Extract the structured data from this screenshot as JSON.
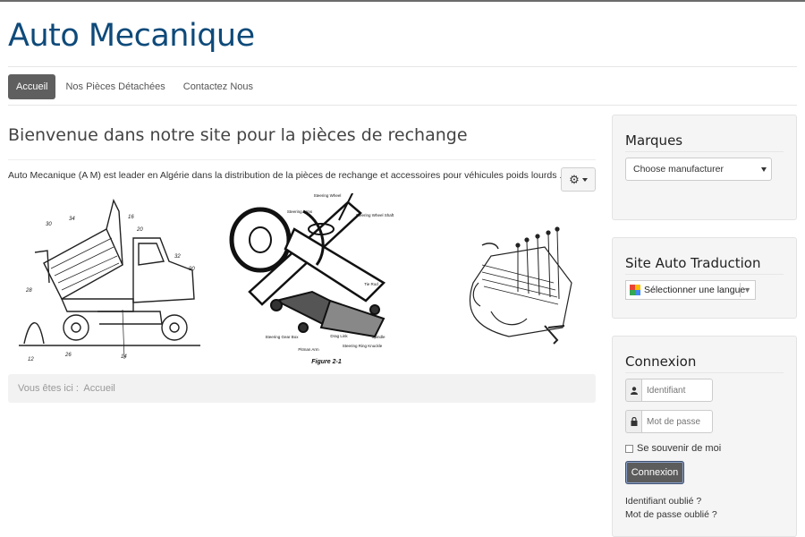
{
  "site": {
    "title": "Auto Mecanique"
  },
  "nav": {
    "items": [
      {
        "label": "Accueil",
        "active": true
      },
      {
        "label": "Nos Pièces Détachées",
        "active": false
      },
      {
        "label": "Contactez Nous",
        "active": false
      }
    ]
  },
  "main": {
    "heading": "Bienvenue dans notre site pour la pièces de rechange",
    "intro": "Auto Mecanique (A M) est leader en Algérie dans la distribution de la pièces de rechange et accessoires pour véhicules poids lourds ....",
    "images": {
      "truck": {
        "labels": [
          "30",
          "34",
          "16",
          "20",
          "32",
          "90",
          "28",
          "12",
          "26",
          "14"
        ]
      },
      "steering": {
        "labels": [
          "Steering Wheel",
          "Steering Arms",
          "Steering Wheel Shaft",
          "Tie Rod",
          "Steering Gear Box",
          "Pitman Arm",
          "Drag Link",
          "Spindle",
          "Steering Ring Knuckle"
        ],
        "caption": "Figure 2-1"
      }
    },
    "breadcrumb": {
      "prefix": "Vous êtes ici :",
      "current": "Accueil"
    }
  },
  "sidebar": {
    "marques": {
      "title": "Marques",
      "select_value": "Choose manufacturer"
    },
    "translate": {
      "title": "Site Auto Traduction",
      "select_value": "Sélectionner une langue"
    },
    "login": {
      "title": "Connexion",
      "username_placeholder": "Identifiant",
      "password_placeholder": "Mot de passe",
      "remember_label": "Se souvenir de moi",
      "submit_label": "Connexion",
      "forgot_username": "Identifiant oublié ?",
      "forgot_password": "Mot de passe oublié ?"
    }
  },
  "colors": {
    "title": "#0e4a7a",
    "nav_active": "#5f5f5f",
    "well_bg": "#f5f5f5"
  }
}
